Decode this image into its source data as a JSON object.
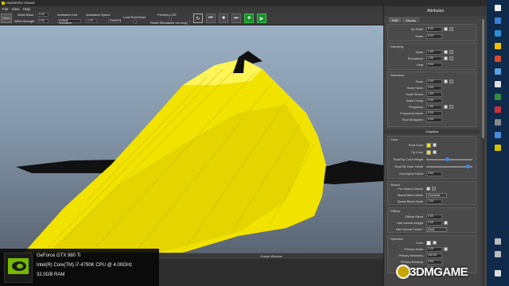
{
  "window": {
    "title": "HairWorks Viewer"
  },
  "menu": [
    "File",
    "View",
    "Help"
  ],
  "toolbar": {
    "open_label": "Open",
    "wind_noise_label": "Wind Noise",
    "wind_noise_value": "0.00",
    "wind_strength_label": "Wind Strength",
    "wind_strength_value": "0.00",
    "animation_list_label": "Animation List",
    "animation_list_value": "Default Animation",
    "animation_speed_label": "Animation Speed",
    "animation_speed_value": "1.00",
    "anim_mode_value": "Disabled",
    "lock_root_bone_label": "Lock Root Bone",
    "preview_lod_label": "Preview LOD",
    "reset_sim_label": "Reset Simulation on Loop"
  },
  "viewport": {
    "gizmo_label": "Y"
  },
  "output": {
    "title": "Output Window"
  },
  "gpu_overlay": {
    "gpu": "GeForce GTX 980 Ti",
    "cpu": "Intel(R) Core(TM) i7-4790K CPU @ 4.00GHz",
    "ram": "32.0GB RAM"
  },
  "attributes": {
    "title": "Attributes",
    "tabs": [
      "Hair",
      "Display"
    ],
    "top_rows": [
      {
        "label": "Tip Scale",
        "value": "0.00"
      },
      {
        "label": "Mode",
        "value": "0.00"
      }
    ],
    "damping": {
      "title": "Damping",
      "rows": [
        {
          "label": "Scale",
          "value": "1.00"
        },
        {
          "label": "Roundness",
          "value": "1.00"
        },
        {
          "label": "Heat",
          "value": "0.00"
        }
      ]
    },
    "waviness": {
      "title": "Waviness",
      "rows": [
        {
          "label": "Scale",
          "value": "0.00"
        },
        {
          "label": "Scale Noise",
          "value": "0.00"
        },
        {
          "label": "Scale Strand",
          "value": "1.00"
        },
        {
          "label": "Scale Clump",
          "value": "0.00"
        },
        {
          "label": "Frequency",
          "value": "1.00"
        },
        {
          "label": "Frequency Noise",
          "value": "0.00"
        },
        {
          "label": "Root Straighten",
          "value": "0.00"
        }
      ]
    },
    "graphics_header": "Graphics",
    "color": {
      "title": "Color",
      "root_color_label": "Root Color",
      "tip_color_label": "Tip Color",
      "root_tip_weight_label": "Root/Tip Color Weight",
      "root_tip_weight_level": 0.45,
      "root_tip_falloff_label": "Root/Tip Color Falloff",
      "root_tip_falloff_level": 0.95,
      "root_alpha_falloff_label": "Root Alpha Falloff",
      "root_alpha_falloff_value": "0.00",
      "swatch_color": "#f3e400"
    },
    "strand": {
      "title": "Strand",
      "per_strand_texture_label": "Per Strand Texture",
      "blend_mode_label": "Strand Blend Mode",
      "blend_mode_value": "Overwrite",
      "blend_scale_label": "Strand Blend Scale",
      "blend_scale_value": "1.00"
    },
    "diffuse": {
      "title": "Diffuse",
      "rows": [
        {
          "label": "Diffuse Blend",
          "value": "0.00"
        },
        {
          "label": "Hair Normal Weight",
          "value": "0.00"
        }
      ],
      "hair_normal_center_label": "Hair Normal Center*",
      "hair_normal_center_value": "(null)"
    },
    "specular": {
      "title": "Specular",
      "color_label": "Color",
      "rows": [
        {
          "label": "Primary Scale",
          "value": "0.10"
        },
        {
          "label": "Primary Shininess",
          "value": "100.00"
        },
        {
          "label": "Primary Breakup",
          "value": "0.00"
        },
        {
          "label": "Secondary",
          "value": "0.00"
        }
      ]
    }
  },
  "watermark": {
    "text": "3DMGAME"
  },
  "colors": {
    "hair": "#f2e200",
    "viewport_top": "#9cb0c4",
    "accent_green": "#1f8f2c"
  }
}
